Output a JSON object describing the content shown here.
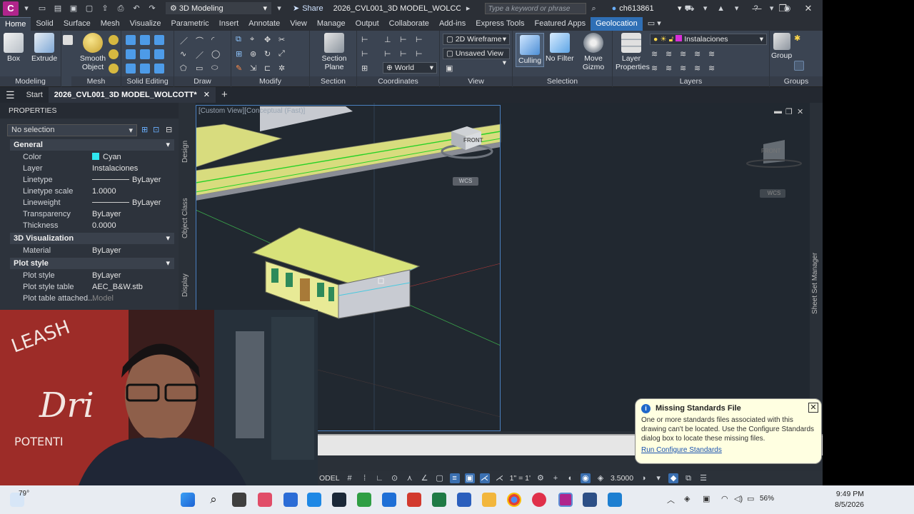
{
  "titlebar": {
    "app_letter": "C",
    "workspace": "3D Modeling",
    "share": "Share",
    "doc_title": "2026_CVL001_3D MODEL_WOLCOTT.d...",
    "search_placeholder": "Type a keyword or phrase",
    "user": "ch613861"
  },
  "ribbon_tabs": [
    "Home",
    "Solid",
    "Surface",
    "Mesh",
    "Visualize",
    "Parametric",
    "Insert",
    "Annotate",
    "View",
    "Manage",
    "Output",
    "Collaborate",
    "Add-ins",
    "Express Tools",
    "Featured Apps",
    "Geolocation"
  ],
  "ribbon": {
    "box": "Box",
    "extrude": "Extrude",
    "smooth_object": "Smooth Object",
    "section_plane": "Section Plane",
    "culling": "Culling",
    "no_filter": "No Filter",
    "move_gizmo": "Move Gizmo",
    "layer_properties": "Layer Properties",
    "group": "Group",
    "visual_style": "2D Wireframe",
    "view_combo": "Unsaved View",
    "ucs_combo": "World",
    "layer_combo": "Instalaciones",
    "panels": [
      "Modeling",
      "Mesh",
      "Solid Editing",
      "Draw",
      "Modify",
      "Section",
      "Coordinates",
      "View",
      "Selection",
      "Layers",
      "Groups"
    ]
  },
  "filetabs": {
    "start": "Start",
    "active": "2026_CVL001_3D MODEL_WOLCOTT*"
  },
  "properties": {
    "title": "PROPERTIES",
    "selection": "No selection",
    "sections": {
      "general": "General",
      "viz": "3D Visualization",
      "plot": "Plot style"
    },
    "general_rows": [
      {
        "label": "Color",
        "value": "Cyan"
      },
      {
        "label": "Layer",
        "value": "Instalaciones"
      },
      {
        "label": "Linetype",
        "value": "ByLayer"
      },
      {
        "label": "Linetype scale",
        "value": "1.0000"
      },
      {
        "label": "Lineweight",
        "value": "ByLayer"
      },
      {
        "label": "Transparency",
        "value": "ByLayer"
      },
      {
        "label": "Thickness",
        "value": "0.0000"
      }
    ],
    "viz_rows": [
      {
        "label": "Material",
        "value": "ByLayer"
      }
    ],
    "plot_rows": [
      {
        "label": "Plot style",
        "value": "ByLayer"
      },
      {
        "label": "Plot style table",
        "value": "AEC_B&W.stb"
      },
      {
        "label": "Plot table attached...",
        "value": "Model"
      }
    ],
    "side_tabs": [
      "Design",
      "Object Class",
      "Display"
    ]
  },
  "viewport": {
    "label": "[Custom View][Conceptual (Fast)]",
    "viewcube_face": "FRONT",
    "wcs": "WCS"
  },
  "sheet_set": "Sheet Set Manager",
  "status": {
    "model": "ODEL",
    "scale": "1\" = 1'",
    "value": "3.5000"
  },
  "notification": {
    "title": "Missing Standards File",
    "body": "One or more standards files associated with this drawing can't be located. Use the Configure Standards dialog box to locate these missing files.",
    "link": "Run Configure Standards"
  },
  "taskbar": {
    "temp": "79°",
    "battery": "56%",
    "time": "9:49 PM",
    "date": "8/5/2026"
  },
  "colors": {
    "accent": "#2f6fb5",
    "ribbon": "#3b4452",
    "layer": "#d92fd9",
    "cyan": "#2fe6ef"
  }
}
